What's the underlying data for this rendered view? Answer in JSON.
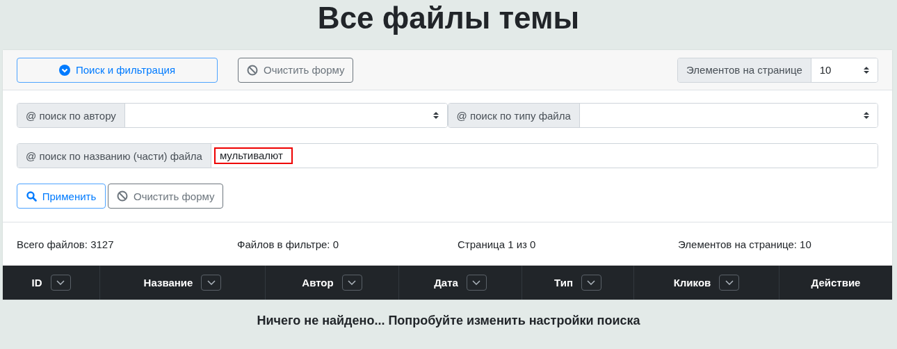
{
  "title": "Все файлы темы",
  "toolbar": {
    "toggle_button": "Поиск и фильтрация",
    "clear_button": "Очистить форму",
    "per_page": {
      "label": "Элементов на странице",
      "value": "10"
    }
  },
  "filters": {
    "author": {
      "label": "@ поиск по автору"
    },
    "file_type": {
      "label": "@ поиск по типу файла"
    },
    "name": {
      "label": "@ поиск по названию (части) файла",
      "value": "мультивалют",
      "highlighted": true
    },
    "apply_button": "Применить",
    "clear_button": "Очистить форму"
  },
  "stats": [
    "Всего файлов: 3127",
    "Файлов в фильтре: 0",
    "Страница 1 из 0",
    "Элементов на странице: 10"
  ],
  "table": {
    "columns": [
      {
        "label": "ID",
        "sortable": true
      },
      {
        "label": "Название",
        "sortable": true
      },
      {
        "label": "Автор",
        "sortable": true
      },
      {
        "label": "Дата",
        "sortable": true
      },
      {
        "label": "Тип",
        "sortable": true
      },
      {
        "label": "Кликов",
        "sortable": true
      },
      {
        "label": "Действие",
        "sortable": false
      }
    ]
  },
  "empty_message": "Ничего не найдено... Попробуйте изменить настройки поиска"
}
